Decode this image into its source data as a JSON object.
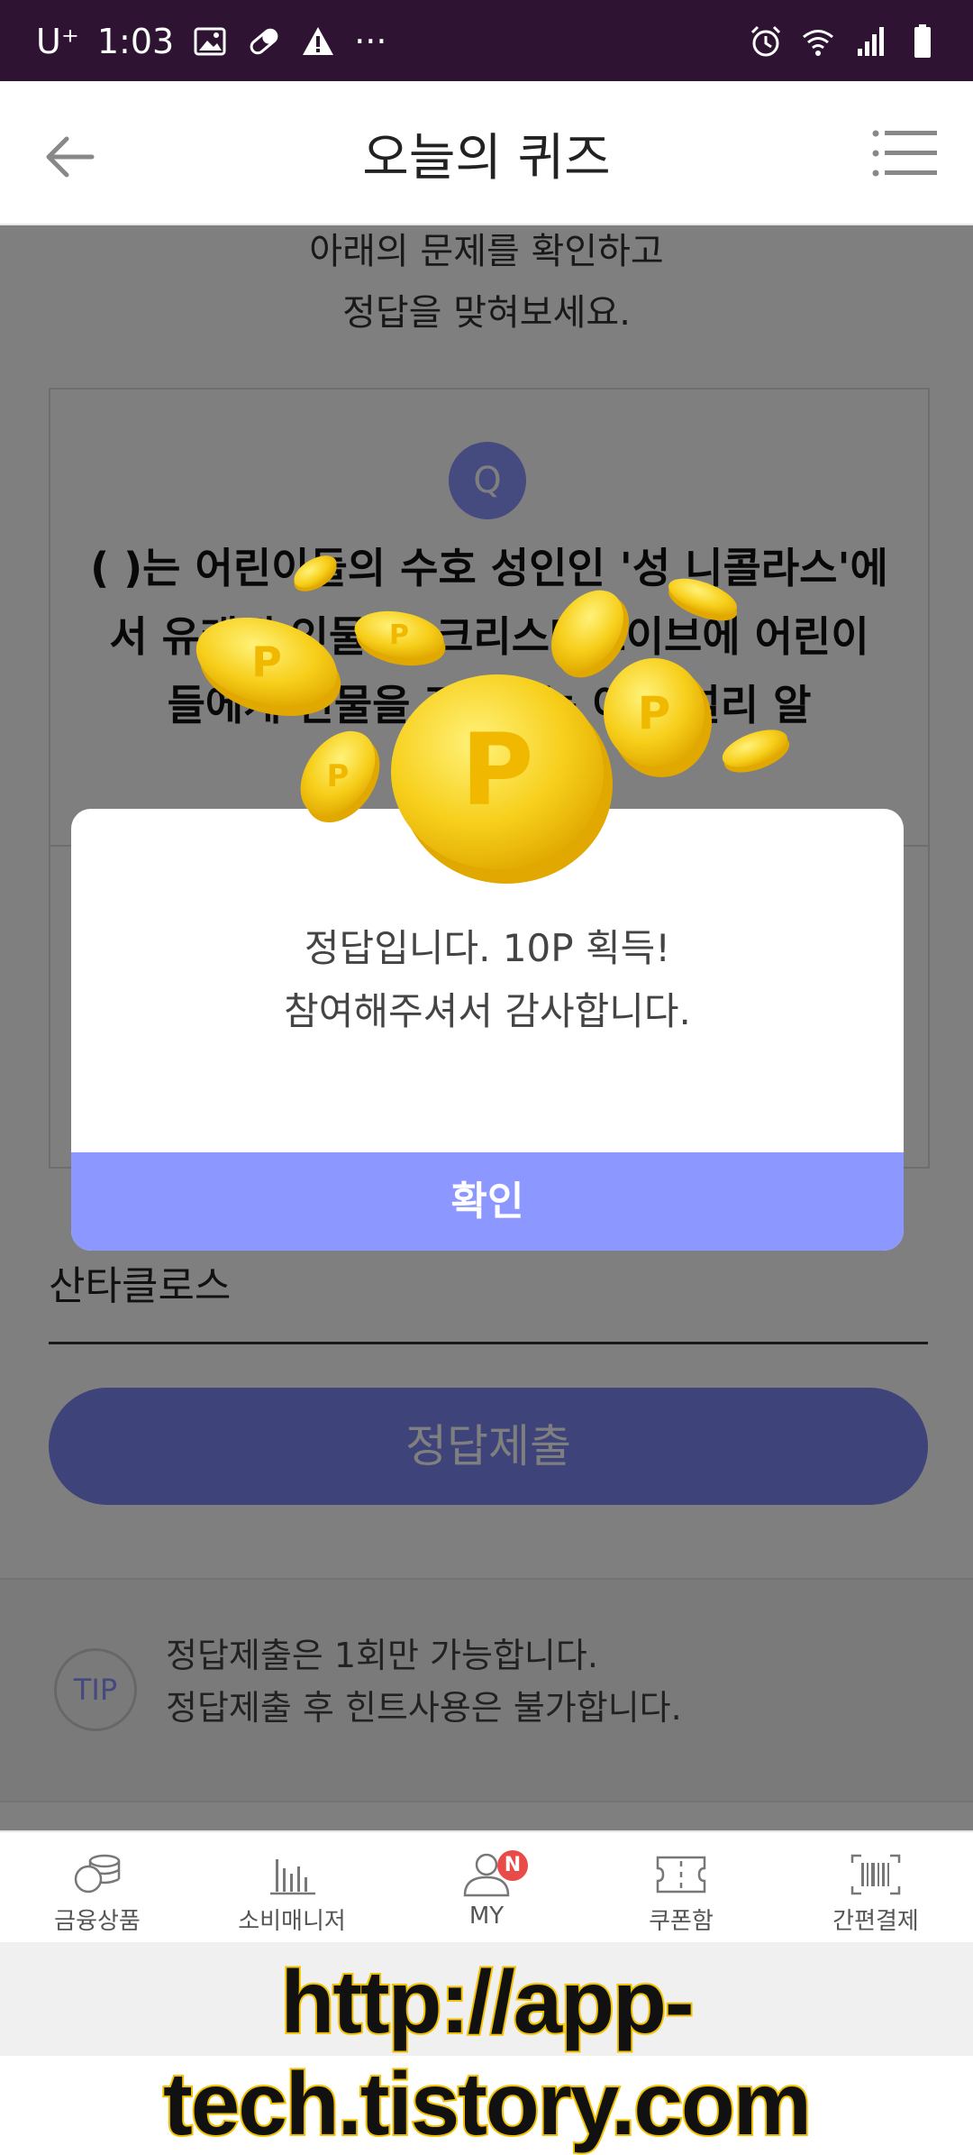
{
  "status_bar": {
    "carrier": "U⁺",
    "time": "1:03",
    "more": "···"
  },
  "header": {
    "title": "오늘의 퀴즈"
  },
  "quiz": {
    "intro_line1": "아래의 문제를 확인하고",
    "intro_line2": "정답을 맞혀보세요.",
    "q_badge": "Q",
    "question_line1": "( )는 어린이들의 수호 성인인 '성 니콜라스'에",
    "question_line2": "서 유래된 인물로, 크리스마스이브에 어린이",
    "question_line3": "들에게 선물을 전해주는 이로 널리 알",
    "answer_value": "산타클로스",
    "submit_label": "정답제출",
    "tip_badge": "TIP",
    "tip_line1": "정답제출은 1회만 가능합니다.",
    "tip_line2": "정답제출 후 힌트사용은 불가합니다."
  },
  "dialog": {
    "message_line1": "정답입니다. 10P 획득!",
    "message_line2": "참여해주셔서 감사합니다.",
    "confirm_label": "확인",
    "coin_letter": "P"
  },
  "bottom_nav": {
    "items": [
      {
        "label": "금융상품",
        "icon": "coins-stack-icon"
      },
      {
        "label": "소비매니저",
        "icon": "bar-chart-icon"
      },
      {
        "label": "MY",
        "icon": "person-icon",
        "badge": "N"
      },
      {
        "label": "쿠폰함",
        "icon": "ticket-icon"
      },
      {
        "label": "간편결제",
        "icon": "barcode-icon"
      }
    ]
  },
  "watermark": {
    "text": "http://app-tech.tistory.com"
  },
  "colors": {
    "status_bar": "#2e1333",
    "accent": "#8c98ff",
    "badge": "#e84b48",
    "coin": "#f7cf1b"
  }
}
